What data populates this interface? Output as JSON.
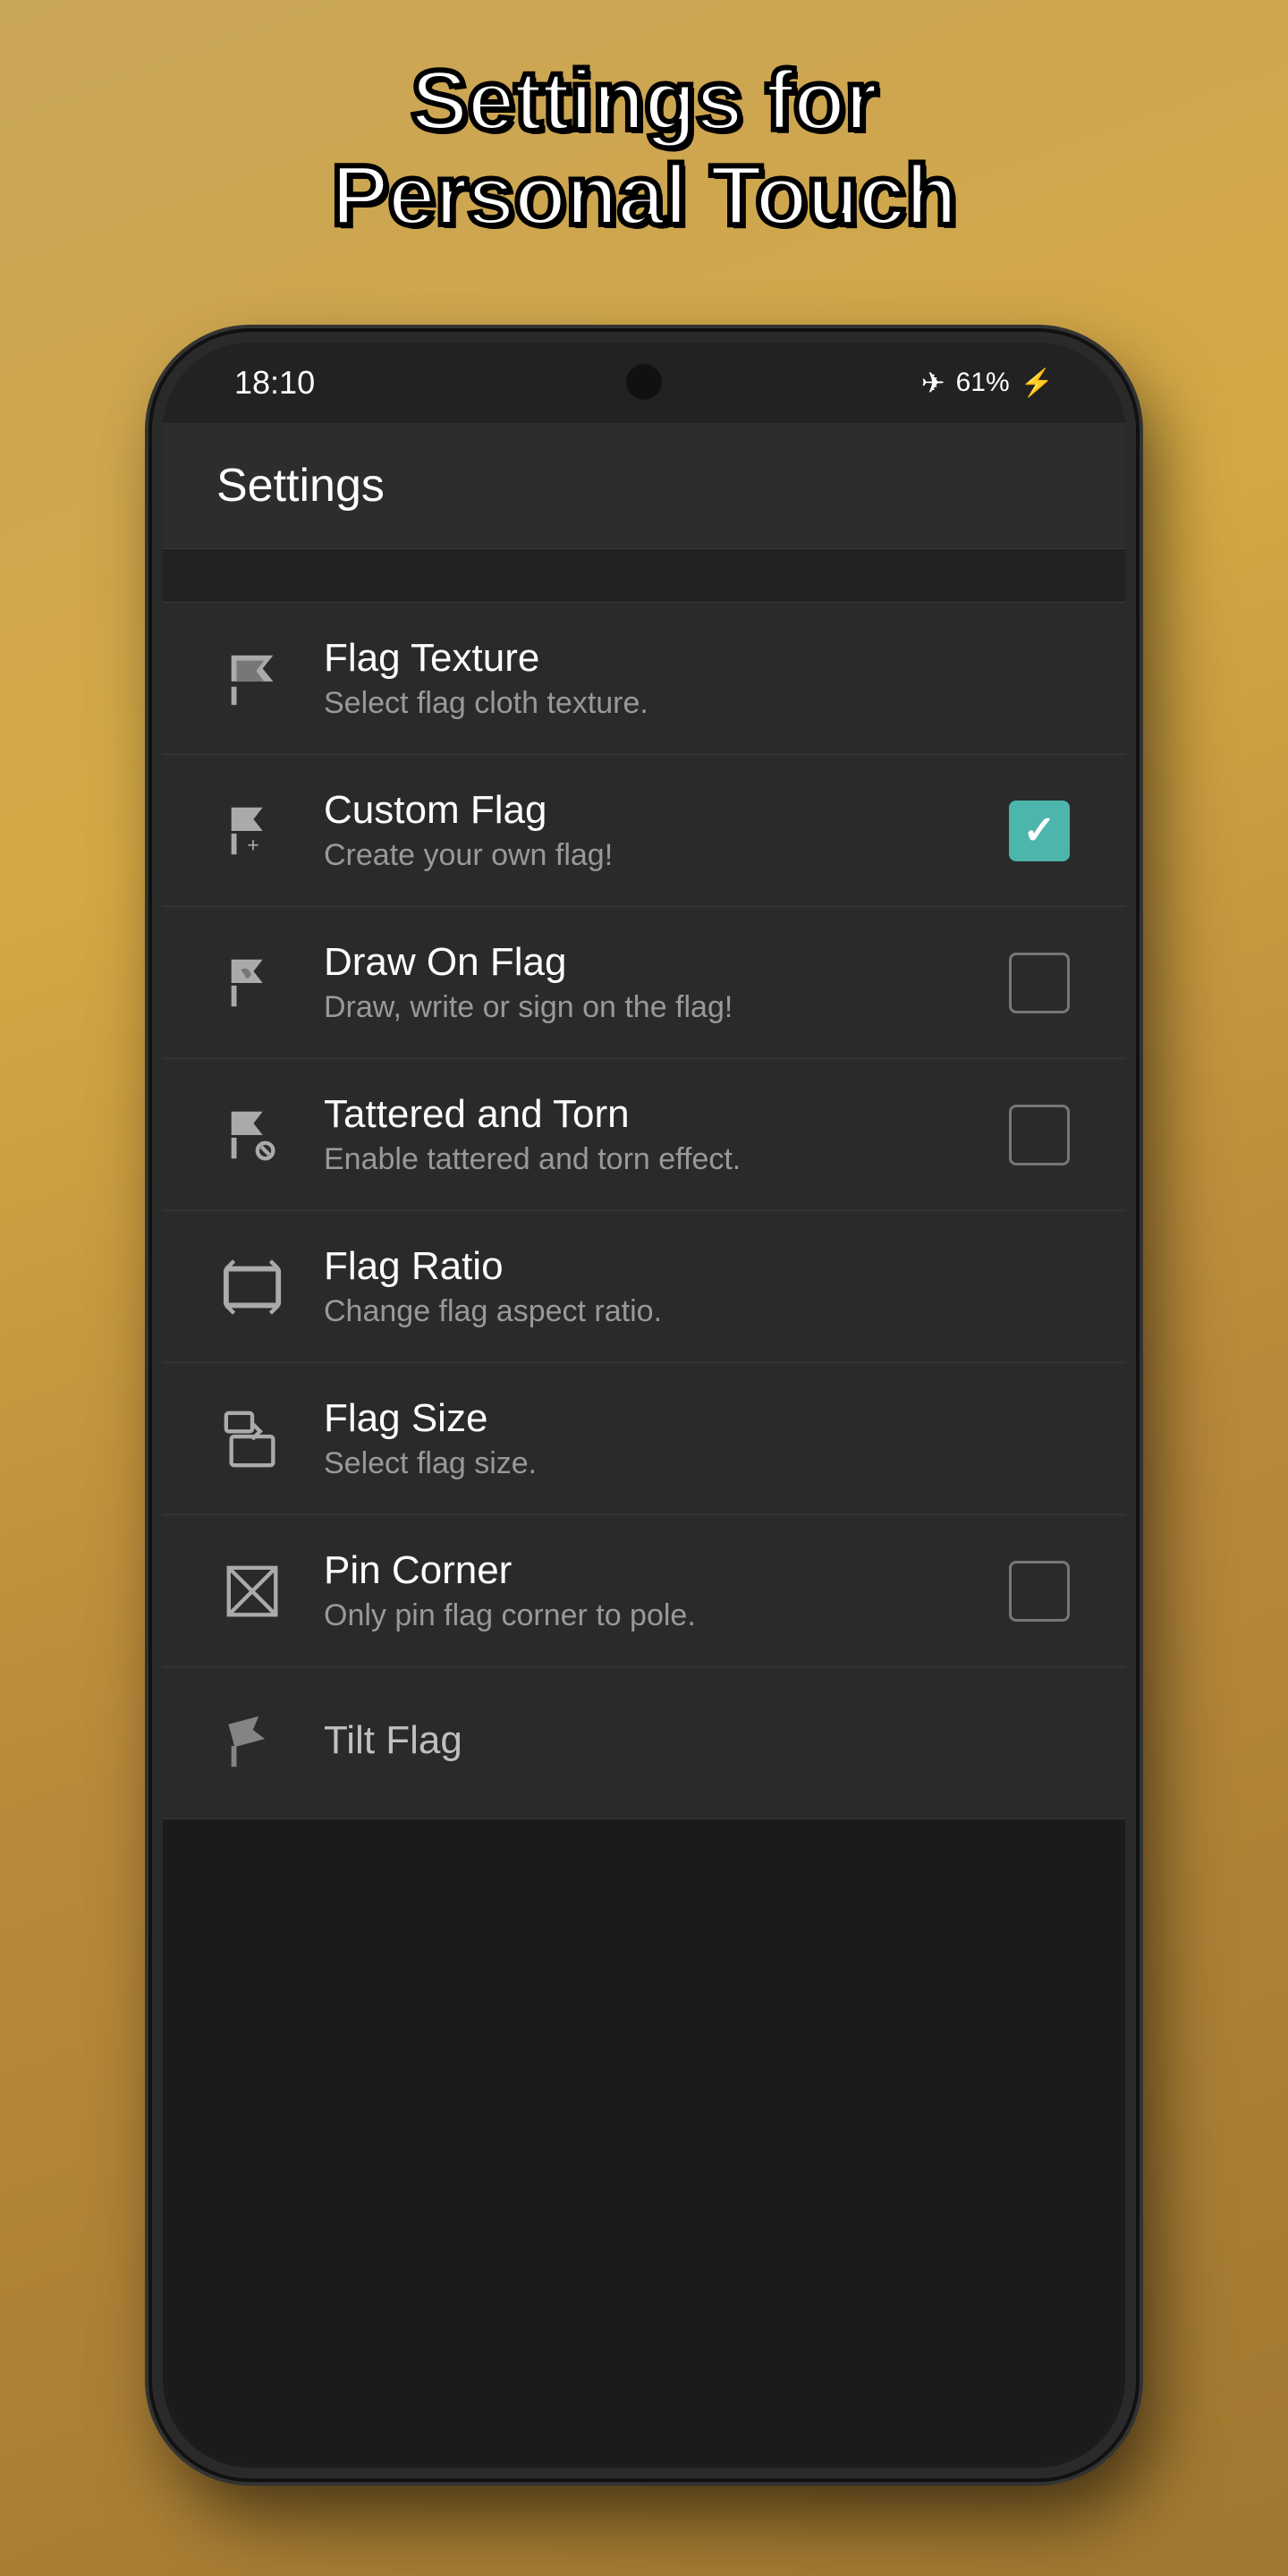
{
  "page": {
    "title_line1": "Settings for",
    "title_line2": "Personal Touch"
  },
  "status_bar": {
    "time": "18:10",
    "battery": "61%",
    "airplane_icon": "✈",
    "battery_icon": "⚡"
  },
  "header": {
    "title": "Settings"
  },
  "settings_items": [
    {
      "id": "flag-texture",
      "title": "Flag Texture",
      "subtitle": "Select flag cloth texture.",
      "has_checkbox": false,
      "checked": null,
      "icon": "flag-texture-icon"
    },
    {
      "id": "custom-flag",
      "title": "Custom Flag",
      "subtitle": "Create your own flag!",
      "has_checkbox": true,
      "checked": true,
      "icon": "custom-flag-icon"
    },
    {
      "id": "draw-on-flag",
      "title": "Draw On Flag",
      "subtitle": "Draw, write or sign on the flag!",
      "has_checkbox": true,
      "checked": false,
      "icon": "draw-flag-icon"
    },
    {
      "id": "tattered-torn",
      "title": "Tattered and Torn",
      "subtitle": "Enable tattered and torn effect.",
      "has_checkbox": true,
      "checked": false,
      "icon": "tattered-icon"
    },
    {
      "id": "flag-ratio",
      "title": "Flag Ratio",
      "subtitle": "Change flag aspect ratio.",
      "has_checkbox": false,
      "checked": null,
      "icon": "ratio-icon"
    },
    {
      "id": "flag-size",
      "title": "Flag Size",
      "subtitle": "Select flag size.",
      "has_checkbox": false,
      "checked": null,
      "icon": "size-icon"
    },
    {
      "id": "pin-corner",
      "title": "Pin Corner",
      "subtitle": "Only pin flag corner to pole.",
      "has_checkbox": true,
      "checked": false,
      "icon": "pin-icon"
    },
    {
      "id": "tilt-flag",
      "title": "Tilt Flag",
      "subtitle": "",
      "has_checkbox": false,
      "checked": null,
      "icon": "tilt-icon"
    }
  ]
}
